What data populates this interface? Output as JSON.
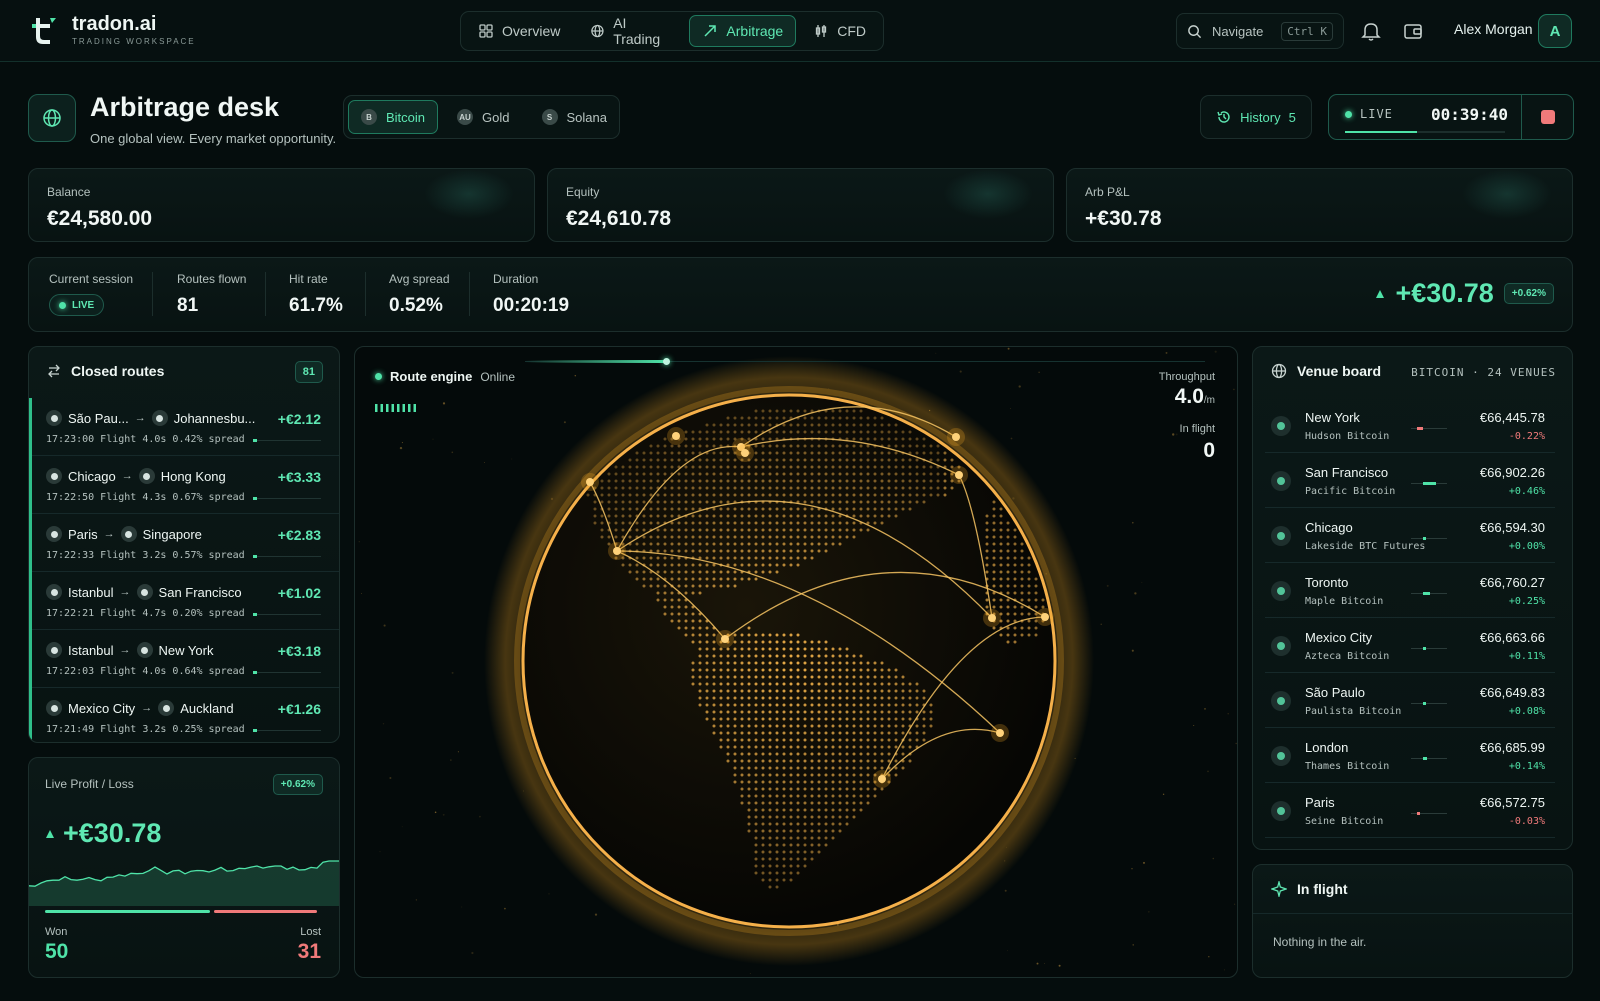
{
  "app": {
    "name": "tradon.ai",
    "subtitle": "TRADING WORKSPACE"
  },
  "nav": {
    "tabs": [
      {
        "label": "Overview",
        "icon": "grid-icon"
      },
      {
        "label": "AI Trading",
        "icon": "globe-icon"
      },
      {
        "label": "Arbitrage",
        "icon": "trend-arrow-icon"
      },
      {
        "label": "CFD",
        "icon": "candles-icon"
      }
    ],
    "active": "Arbitrage"
  },
  "search": {
    "placeholder": "Navigate",
    "shortcut": "Ctrl K"
  },
  "user": {
    "name": "Alex Morgan",
    "initial": "A"
  },
  "desk": {
    "title": "Arbitrage desk",
    "subtitle": "One global view. Every market opportunity.",
    "assets": [
      {
        "label": "Bitcoin",
        "symbol": "B"
      },
      {
        "label": "Gold",
        "symbol": "AU"
      },
      {
        "label": "Solana",
        "symbol": "S"
      }
    ],
    "active_asset": "Bitcoin",
    "history": {
      "label": "History",
      "count": "5"
    },
    "live": {
      "label": "LIVE",
      "time": "00:39:40"
    }
  },
  "stats": [
    {
      "label": "Balance",
      "value": "€24,580.00"
    },
    {
      "label": "Equity",
      "value": "€24,610.78"
    },
    {
      "label": "Arb P&L",
      "value": "+€30.78"
    }
  ],
  "session": {
    "current_label": "Current session",
    "live_badge": "LIVE",
    "routes_label": "Routes flown",
    "routes": "81",
    "hit_label": "Hit rate",
    "hit": "61.7%",
    "spread_label": "Avg spread",
    "spread": "0.52%",
    "duration_label": "Duration",
    "duration": "00:20:19",
    "pnl": "+€30.78",
    "pnl_pct": "+0.62%"
  },
  "closed_routes": {
    "title": "Closed routes",
    "count": "81",
    "items": [
      {
        "from": "São Pau...",
        "to": "Johannesbu...",
        "pnl": "+€2.12",
        "meta": "17:23:00  Flight 4.0s  0.42% spread"
      },
      {
        "from": "Chicago",
        "to": "Hong Kong",
        "pnl": "+€3.33",
        "meta": "17:22:50  Flight 4.3s  0.67% spread"
      },
      {
        "from": "Paris",
        "to": "Singapore",
        "pnl": "+€2.83",
        "meta": "17:22:33  Flight 3.2s  0.57% spread"
      },
      {
        "from": "Istanbul",
        "to": "San Francisco",
        "pnl": "+€1.02",
        "meta": "17:22:21  Flight 4.7s  0.20% spread"
      },
      {
        "from": "Istanbul",
        "to": "New York",
        "pnl": "+€3.18",
        "meta": "17:22:03  Flight 4.0s  0.64% spread"
      },
      {
        "from": "Mexico City",
        "to": "Auckland",
        "pnl": "+€1.26",
        "meta": "17:21:49  Flight 3.2s  0.25% spread"
      }
    ]
  },
  "live_pnl": {
    "title": "Live Profit / Loss",
    "pct": "+0.62%",
    "value": "+€30.78",
    "won_label": "Won",
    "won": "50",
    "lost_label": "Lost",
    "lost": "31"
  },
  "engine": {
    "label": "Route engine",
    "status": "Online",
    "throughput_label": "Throughput",
    "throughput": "4.0",
    "throughput_unit": "/m",
    "inflight_label": "In flight",
    "inflight": "0"
  },
  "venue_board": {
    "title": "Venue board",
    "subtitle": "BITCOIN · 24 VENUES",
    "venues": [
      {
        "city": "New York",
        "exchange": "Hudson Bitcoin",
        "price": "€66,445.78",
        "change": "-0.22%"
      },
      {
        "city": "San Francisco",
        "exchange": "Pacific Bitcoin",
        "price": "€66,902.26",
        "change": "+0.46%"
      },
      {
        "city": "Chicago",
        "exchange": "Lakeside BTC Futures",
        "price": "€66,594.30",
        "change": "+0.00%"
      },
      {
        "city": "Toronto",
        "exchange": "Maple Bitcoin",
        "price": "€66,760.27",
        "change": "+0.25%"
      },
      {
        "city": "Mexico City",
        "exchange": "Azteca Bitcoin",
        "price": "€66,663.66",
        "change": "+0.11%"
      },
      {
        "city": "São Paulo",
        "exchange": "Paulista Bitcoin",
        "price": "€66,649.83",
        "change": "+0.08%"
      },
      {
        "city": "London",
        "exchange": "Thames Bitcoin",
        "price": "€66,685.99",
        "change": "+0.14%"
      },
      {
        "city": "Paris",
        "exchange": "Seine Bitcoin",
        "price": "€66,572.75",
        "change": "-0.03%"
      }
    ]
  },
  "in_flight": {
    "title": "In flight",
    "empty": "Nothing in the air."
  },
  "colors": {
    "accent": "#4fe3a8",
    "loss": "#f07a7a",
    "globe": "#f5a623",
    "background": "#050d0d"
  }
}
